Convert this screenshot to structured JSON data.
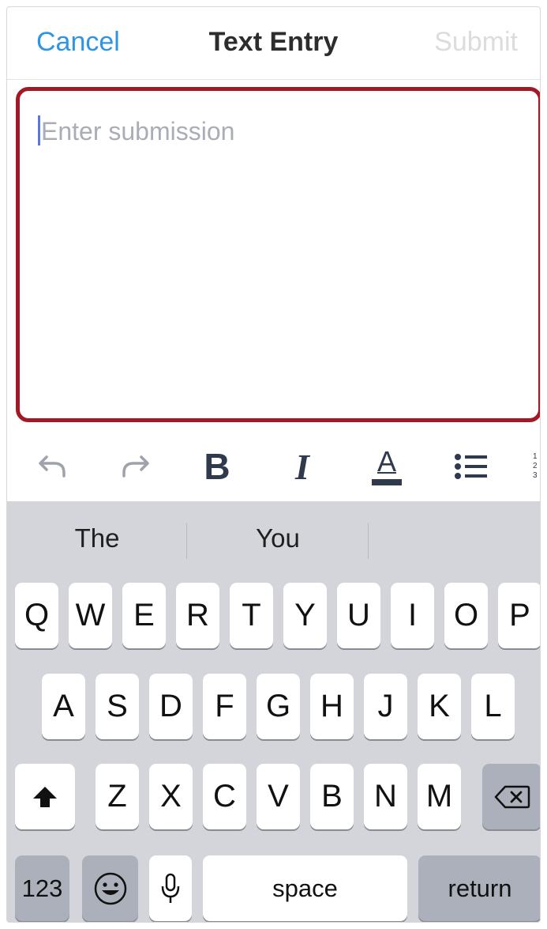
{
  "navbar": {
    "cancel_label": "Cancel",
    "title": "Text Entry",
    "submit_label": "Submit"
  },
  "editor": {
    "placeholder": "Enter submission"
  },
  "toolbar": {
    "items": [
      "undo-icon",
      "redo-icon",
      "bold-icon",
      "italic-icon",
      "text-color-icon",
      "bullet-list-icon",
      "numbered-list-icon"
    ],
    "bold_glyph": "B",
    "italic_glyph": "I",
    "color_glyph": "A"
  },
  "keyboard": {
    "suggestions": [
      "The",
      "You",
      ""
    ],
    "row1": [
      "Q",
      "W",
      "E",
      "R",
      "T",
      "Y",
      "U",
      "I",
      "O",
      "P"
    ],
    "row2": [
      "A",
      "S",
      "D",
      "F",
      "G",
      "H",
      "J",
      "K",
      "L"
    ],
    "row3": [
      "Z",
      "X",
      "C",
      "V",
      "B",
      "N",
      "M"
    ],
    "numbers_label": "123",
    "space_label": "space",
    "return_label": "return"
  },
  "colors": {
    "accent_blue": "#2d95e6",
    "editor_border": "#a31826",
    "caret": "#5b77d9"
  }
}
